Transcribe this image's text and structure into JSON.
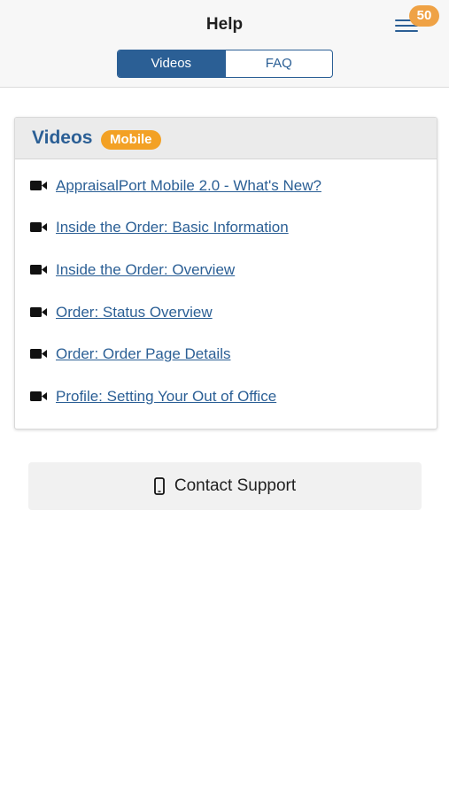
{
  "header": {
    "title": "Help",
    "notification_count": "50",
    "menu_icon": "hamburger-menu-icon"
  },
  "tabs": [
    {
      "label": "Videos",
      "active": true
    },
    {
      "label": "FAQ",
      "active": false
    }
  ],
  "videos_card": {
    "title": "Videos",
    "tag": "Mobile",
    "items": [
      {
        "label": "AppraisalPort Mobile 2.0 - What's New?",
        "icon": "video-camera-icon"
      },
      {
        "label": "Inside the Order: Basic Information",
        "icon": "video-camera-icon"
      },
      {
        "label": "Inside the Order: Overview",
        "icon": "video-camera-icon"
      },
      {
        "label": "Order: Status Overview",
        "icon": "video-camera-icon"
      },
      {
        "label": "Order: Order Page Details",
        "icon": "video-camera-icon"
      },
      {
        "label": "Profile: Setting Your Out of Office",
        "icon": "video-camera-icon"
      }
    ]
  },
  "support": {
    "label": "Contact Support",
    "icon": "mobile-phone-icon"
  },
  "colors": {
    "primary": "#2b5f95",
    "badge": "#efa245",
    "tag": "#f3a125",
    "header_bg": "#f7f7f7",
    "card_head_bg": "#ebebeb",
    "support_bg": "#f1f1f1"
  }
}
